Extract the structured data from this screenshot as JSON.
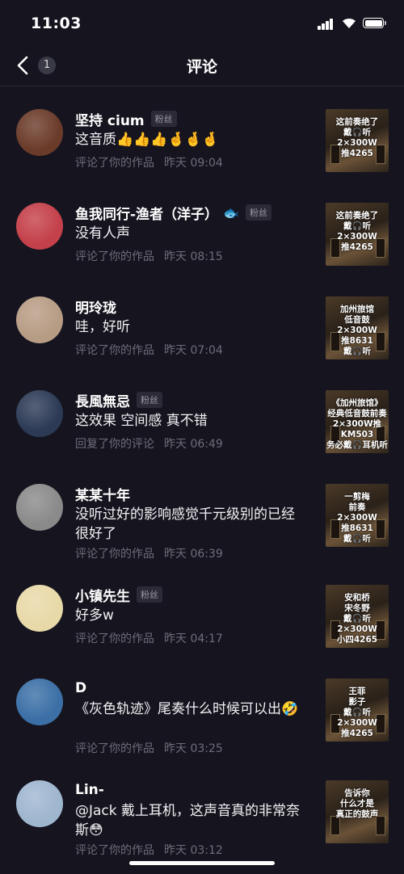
{
  "status": {
    "time": "11:03"
  },
  "nav": {
    "badge": "1",
    "title": "评论"
  },
  "fan_label": "粉丝",
  "items": [
    {
      "name": "坚持 cium",
      "fan": true,
      "comment": "这音质👍👍👍🤞🤞🤞",
      "action": "评论了你的作品",
      "time": "昨天 09:04",
      "thumb": "这前奏绝了\n戴🎧听\n2×300W\n推4265",
      "avatar": "#6b3b2a"
    },
    {
      "name": "鱼我同行-渔者（洋子）",
      "fish": "🐟",
      "fan": true,
      "comment": "没有人声",
      "action": "评论了你的作品",
      "time": "昨天 08:15",
      "thumb": "这前奏绝了\n戴🎧听\n2×300W\n推4265",
      "avatar": "#c4404a"
    },
    {
      "name": "明玲珑",
      "fan": false,
      "comment": "哇，好听",
      "action": "评论了你的作品",
      "time": "昨天 07:04",
      "thumb": "加州旅馆\n低音鼓\n2×300W\n推8631\n戴🎧听",
      "avatar": "#b79c84"
    },
    {
      "name": "長風無忌",
      "fan": true,
      "comment": "这效果 空间感 真不错",
      "action": "回复了你的评论",
      "time": "昨天 06:49",
      "thumb": "《加州旅馆》\n经典低音鼓前奏\n2×300W推KM503\n务必戴🎧耳机听",
      "avatar": "#2c3a55"
    },
    {
      "name": "某某十年",
      "fan": false,
      "comment": "没听过好的影响感觉千元级别的已经很好了",
      "action": "评论了你的作品",
      "time": "昨天 06:39",
      "thumb": "一剪梅\n前奏\n2×300W\n推8631\n戴🎧听",
      "avatar": "#8a8a8a"
    },
    {
      "name": "小镇先生",
      "fan": true,
      "comment": "好多w",
      "action": "评论了你的作品",
      "time": "昨天 04:17",
      "thumb": "安和桥\n宋冬野\n戴🎧听\n2×300W\n小四4265",
      "avatar": "#e8d9a8"
    },
    {
      "name": "D",
      "fan": false,
      "comment": "《灰色轨迹》尾奏什么时候可以出🤣",
      "action": "评论了你的作品",
      "time": "昨天 03:25",
      "thumb": "王菲\n影子\n戴🎧听\n2×300W\n推4265",
      "avatar": "#3b6fa6"
    },
    {
      "name": "Lin-",
      "fan": false,
      "comment": "@Jack 戴上耳机，这声音真的非常奈斯😳",
      "action": "评论了你的作品",
      "time": "昨天 03:12",
      "thumb": "告诉你\n什么才是\n真正的鼓声",
      "avatar": "#9fb6cf"
    }
  ]
}
